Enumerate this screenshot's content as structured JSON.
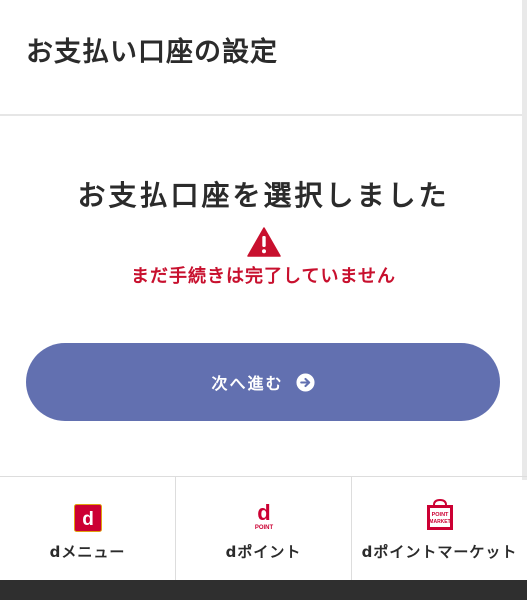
{
  "header": {
    "title": "お支払い口座の設定"
  },
  "main": {
    "heading": "お支払口座を選択しました",
    "warning": "まだ手続きは完了していません",
    "next_button_label": "次へ進む"
  },
  "footer": {
    "links": [
      {
        "label": "dメニュー",
        "icon": "d-menu-icon"
      },
      {
        "label": "dポイント",
        "icon": "d-point-icon"
      },
      {
        "label": "dポイントマーケット",
        "icon": "d-point-market-icon"
      }
    ],
    "icon_texts": {
      "d": "d",
      "point": "POINT",
      "market_top": "POINT",
      "market_bottom": "MARKET"
    }
  },
  "colors": {
    "accent_button": "#6270b0",
    "warning_red": "#c8102e",
    "docomo_red": "#cc0033",
    "footer_bar": "#2f2f2f"
  }
}
